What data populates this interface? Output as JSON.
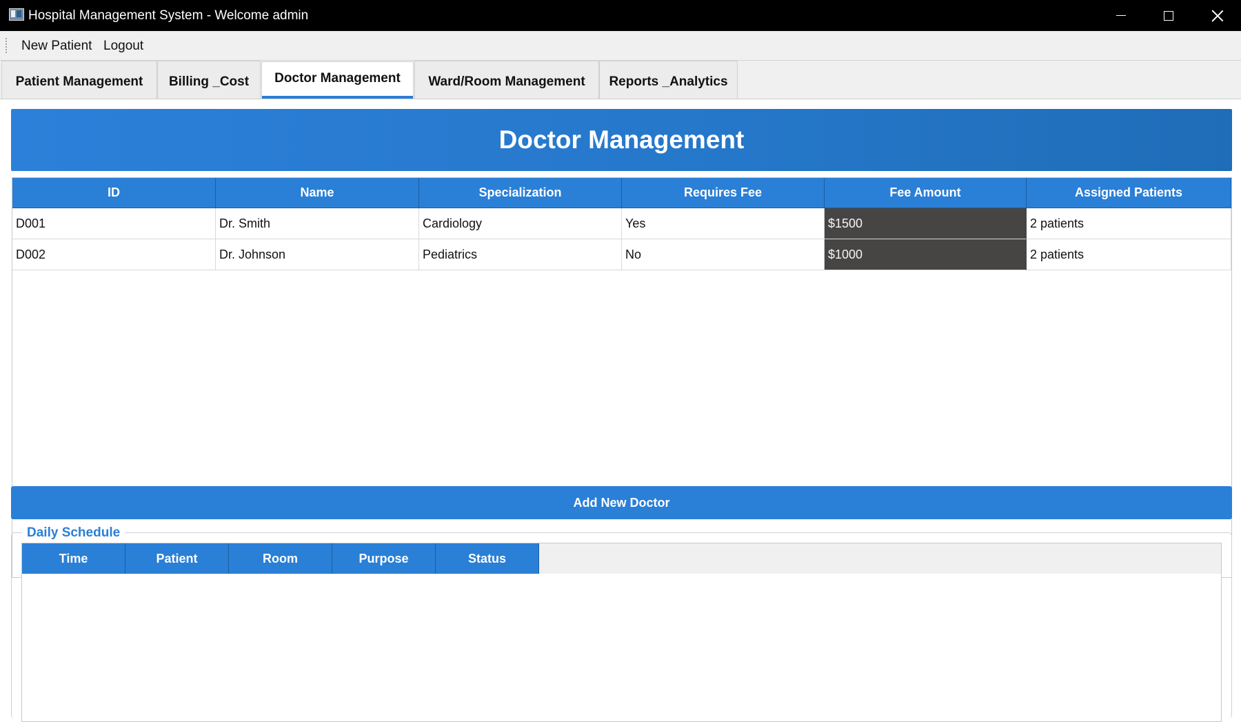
{
  "window": {
    "title": "Hospital Management System - Welcome admin"
  },
  "menu": {
    "items": [
      "New Patient",
      "Logout"
    ]
  },
  "tabs": [
    {
      "label": "Patient Management",
      "active": false
    },
    {
      "label": "Billing _Cost",
      "active": false
    },
    {
      "label": "Doctor Management",
      "active": true
    },
    {
      "label": "Ward/Room Management",
      "active": false
    },
    {
      "label": "Reports _Analytics",
      "active": false
    }
  ],
  "page": {
    "heading": "Doctor Management"
  },
  "doctor_table": {
    "columns": [
      "ID",
      "Name",
      "Specialization",
      "Requires Fee",
      "Fee Amount",
      "Assigned Patients"
    ],
    "rows": [
      [
        "D001",
        "Dr. Smith",
        "Cardiology",
        "Yes",
        "$1500",
        "2 patients"
      ],
      [
        "D002",
        "Dr. Johnson",
        "Pediatrics",
        "No",
        "$1000",
        "2 patients"
      ]
    ]
  },
  "actions": {
    "add_doctor_label": "Add New Doctor"
  },
  "schedule": {
    "legend": "Daily Schedule",
    "columns": [
      "Time",
      "Patient",
      "Room",
      "Purpose",
      "Status"
    ]
  },
  "colors": {
    "accent": "#2a7fd6",
    "fee_cell_bg": "#474544",
    "titlebar_bg": "#000000"
  },
  "icons": {
    "app": "app-window-icon",
    "minimize": "minimize-icon",
    "maximize": "maximize-icon",
    "close": "close-icon"
  }
}
